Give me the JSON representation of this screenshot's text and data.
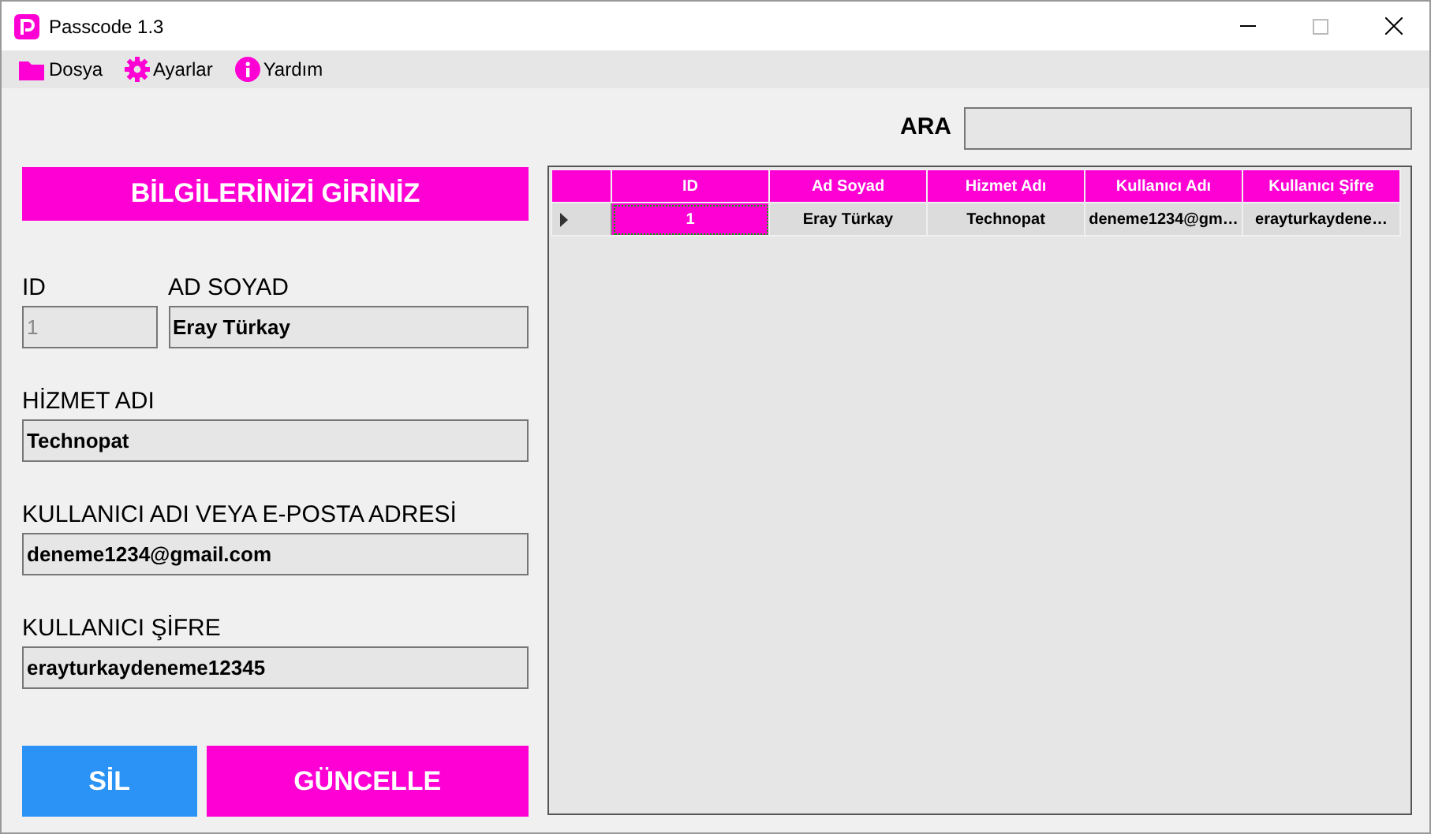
{
  "window": {
    "title": "Passcode 1.3"
  },
  "menu": [
    {
      "label": "Dosya"
    },
    {
      "label": "Ayarlar"
    },
    {
      "label": "Yardım"
    }
  ],
  "search": {
    "label": "ARA"
  },
  "form": {
    "heading": "BİLGİLERİNİZİ GİRİNİZ",
    "fields": [
      {
        "label": "ID",
        "value": "1",
        "disabled": true
      },
      {
        "label": "AD SOYAD",
        "value": "Eray Türkay",
        "disabled": false
      },
      {
        "label": "HİZMET ADI",
        "value": "Technopat",
        "disabled": false
      },
      {
        "label": "KULLANICI ADI VEYA E-POSTA ADRESİ",
        "value": "deneme1234@gmail.com",
        "disabled": false
      },
      {
        "label": "KULLANICI ŞİFRE",
        "value": "erayturkaydeneme12345",
        "disabled": false
      }
    ],
    "buttons": [
      {
        "label": "SİL",
        "kind": "delete"
      },
      {
        "label": "GÜNCELLE",
        "kind": "update"
      }
    ]
  },
  "table": {
    "columns": [
      "ID",
      "Ad Soyad",
      "Hizmet Adı",
      "Kullanıcı Adı",
      "Kullanıcı Şifre"
    ],
    "rows": [
      {
        "selected": true,
        "cells": [
          {
            "text": "1",
            "selected": true
          },
          {
            "text": "Eray Türkay",
            "selected": false
          },
          {
            "text": "Technopat",
            "selected": false
          },
          {
            "text": "deneme1234@gm…",
            "selected": false
          },
          {
            "text": "erayturkaydene…",
            "selected": false
          }
        ]
      }
    ]
  }
}
